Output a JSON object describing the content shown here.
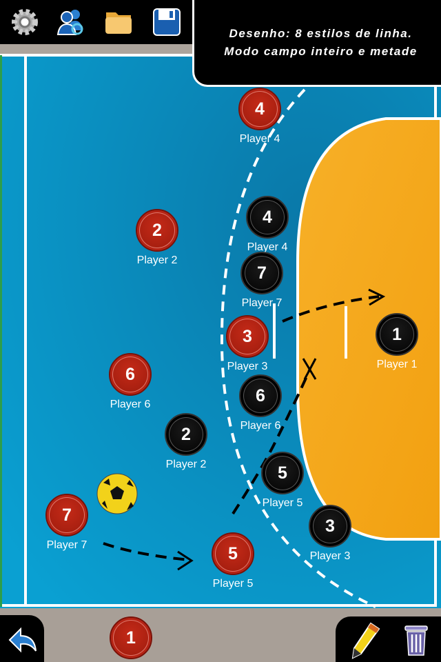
{
  "toolbar": {
    "icons": [
      "gear-icon",
      "users-sync-icon",
      "folder-icon",
      "save-icon"
    ]
  },
  "banner": {
    "line1": "Desenho: 8 estilos de linha.",
    "line2": "Modo campo inteiro e metade"
  },
  "colors": {
    "court": "#0b8fc0",
    "goal_area": "#f5a519",
    "red_team": "#b52314",
    "black_team": "#000000"
  },
  "red_players": [
    {
      "number": "4",
      "label": "Player 4"
    },
    {
      "number": "2",
      "label": "Player 2"
    },
    {
      "number": "3",
      "label": "Player 3"
    },
    {
      "number": "6",
      "label": "Player 6"
    },
    {
      "number": "7",
      "label": "Player 7"
    },
    {
      "number": "5",
      "label": "Player 5"
    }
  ],
  "black_players": [
    {
      "number": "4",
      "label": "Player 4"
    },
    {
      "number": "7",
      "label": "Player 7"
    },
    {
      "number": "1",
      "label": "Player 1"
    },
    {
      "number": "6",
      "label": "Player 6"
    },
    {
      "number": "2",
      "label": "Player 2"
    },
    {
      "number": "5",
      "label": "Player 5"
    },
    {
      "number": "3",
      "label": "Player 3"
    }
  ],
  "bench": {
    "number": "1"
  },
  "bottom": {
    "icons": [
      "undo-icon",
      "pencil-icon",
      "trash-icon"
    ]
  }
}
